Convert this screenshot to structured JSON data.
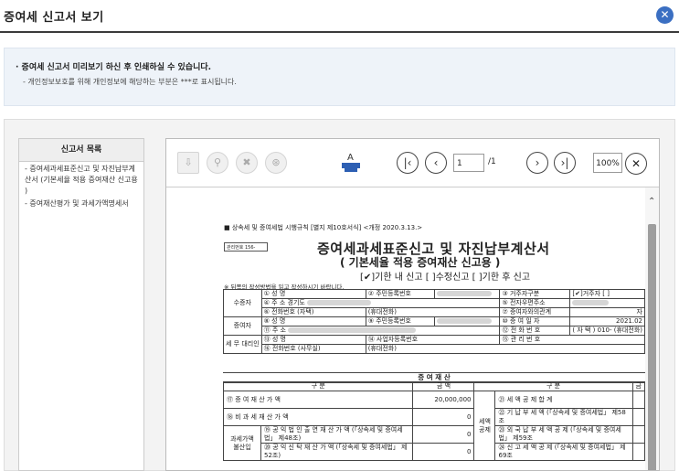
{
  "window": {
    "title": "증여세 신고서 보기"
  },
  "notice": {
    "line1": "· 증여세 신고서 미리보기 하신 후 인쇄하실 수 있습니다.",
    "line2": "- 개인정보보호를 위해 개인정보에 해당하는 부분은 ***로 표시됩니다."
  },
  "list": {
    "header": "신고서 목록",
    "items": [
      "- 증여세과세표준신고 및 자진납부계산서 (기본세율 적용 증여재산 신고용 )",
      "- 증여재산평가 및 과세가액명세서"
    ]
  },
  "toolbar": {
    "page_current": "1",
    "page_total": "/1",
    "zoom": "100%"
  },
  "doc": {
    "law": "■ 상속세 및 증여세법 시행규칙 [별지 제10호서식] <개정 2020.3.13.>",
    "mgmt_label": "관리번호",
    "mgmt_value": "156-",
    "title1": "증여세과세표준신고 및 자진납부계산서",
    "title2": "( 기본세율 적용 증여재산 신고용 )",
    "title3": "[✔]기한 내 신고 [ ]수정신고 [ ]기한 후 신고",
    "note": "※ 뒤쪽의 작성방법을 읽고 작성하시기 바랍니다.",
    "donee_label": "수증자",
    "donor_label": "증여자",
    "agent_label": "세 무 대리인",
    "name": "① 성 명",
    "rrn": "② 주민등록번호",
    "resident_type": "③ 거주자구분",
    "resident_check": "[✔]거주자 [ ]",
    "addr": "④ 주 소",
    "addr_val": "경기도",
    "email": "⑤ 전자우편주소",
    "phone": "⑥ 전화번호 (자택)",
    "mobile": "(휴대전화)",
    "relation": "⑦ 증여자와의관계",
    "relation_val": "자",
    "donor_name": "⑧ 성 명",
    "donor_rrn": "⑨ 주민등록번호",
    "gift_date": "⑩ 증 여 일 자",
    "gift_date_val": "2021.02",
    "donor_addr": "⑪ 주 소",
    "donor_phone": "⑫ 전 화 번 호",
    "donor_phone_val": "( 자 택 ) 010-",
    "donor_mobile": "(휴대전화)",
    "agent_name": "⑬ 성 명",
    "agent_biz": "⑭ 사업자등록번호",
    "agent_mgmt": "⑮ 관 리 번 호",
    "agent_phone": "⑯ 전화번호 (사무실)",
    "agent_mobile": "(휴대전화)",
    "section": "증 여 재 산",
    "col_item": "구 분",
    "col_amount": "금 액",
    "col_item2": "구 분",
    "col_amount2": "금",
    "row1": "⑰ 증 여 재 산 가 액",
    "row1_val": "20,000,000",
    "row2": "⑱ 비 과 세 재 산 가 액",
    "row2_val": "0",
    "row3a": "⑲ 공 익 법 인 출 연 재 산 가 액 (「상속세 및 증여세법」 제48조)",
    "row3a_val": "0",
    "row3b": "⑳ 공 익 신 탁 재 산 가 액 (「상속세 및 증여세법」 제52조)",
    "row3b_val": "0",
    "row3_label": "과세가액 불산입",
    "r_row1": "㉑ 세 액 공 제 합 계",
    "r_row2": "㉒ 기 납 부 세 액 (「상속세 및 증여세법」 제58조",
    "r_row3": "㉓ 외 국 납 부 세 액 공 제 (「상속세 및 증여세법」 제59조",
    "r_row4": "㉔ 신 고 세 액 공 제 (「상속세 및 증여세법」 제69조",
    "r_label": "세액 공제"
  }
}
